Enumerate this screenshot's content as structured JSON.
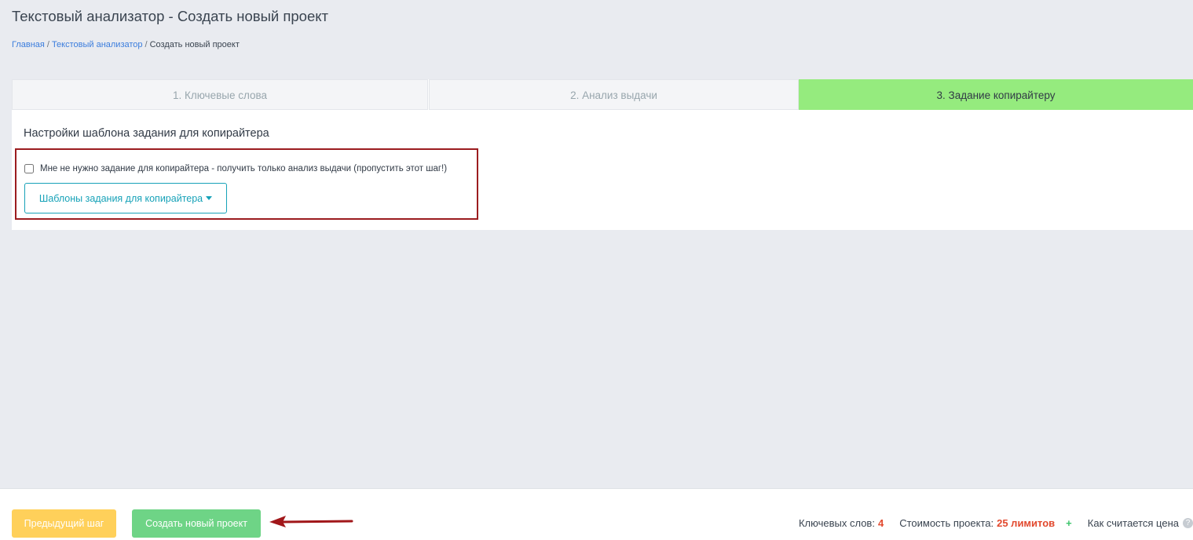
{
  "header": {
    "title": "Текстовый анализатор - Создать новый проект",
    "breadcrumb": {
      "home": "Главная",
      "section": "Текстовый анализатор",
      "current": "Создать новый проект"
    }
  },
  "tabs": [
    {
      "label": "1. Ключевые слова",
      "active": false
    },
    {
      "label": "2. Анализ выдачи",
      "active": false
    },
    {
      "label": "3. Задание копирайтеру",
      "active": true
    }
  ],
  "content": {
    "section_title": "Настройки шаблона задания для копирайтера",
    "skip_checkbox": {
      "label": "Мне не нужно задание для копирайтера - получить только анализ выдачи (пропустить этот шаг!)",
      "checked": false
    },
    "templates_button": "Шаблоны задания для копирайтера"
  },
  "footer": {
    "prev_button": "Предыдущий шаг",
    "create_button": "Создать новый проект",
    "keywords_label": "Ключевых слов:",
    "keywords_count": "4",
    "cost_label": "Стоимость проекта:",
    "cost_value": "25 лимитов",
    "plus_symbol": "+",
    "price_help_label": "Как считается цена",
    "help_symbol": "?"
  },
  "colors": {
    "active_tab": "#95eb7e",
    "highlight_border": "#9b1c1f",
    "prev_button": "#ffd05a",
    "create_button": "#6ed486",
    "accent_red": "#e2492e",
    "templates_button": "#17a2b8"
  },
  "icons": [
    "caret-down-icon",
    "arrow-left-icon",
    "plus-icon",
    "question-circle-icon"
  ]
}
